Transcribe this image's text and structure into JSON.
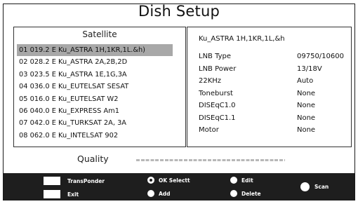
{
  "title": "Dish Setup",
  "satellite_panel": {
    "header": "Satellite",
    "items": [
      "01 019.2 E Ku_ASTRA 1H,1KR,1L.&h)",
      "02 028.2 E Ku_ASTRA 2A,2B,2D",
      "03 023.5 E Ku_ASTRA 1E,1G,3A",
      "04 036.0 E Ku_EUTELSAT SESAT",
      "05 016.0 E Ku_EUTELSAT W2",
      "06 040.0 E Ku_EXPRESS Am1",
      "07 042.0 E Ku_TURKSAT 2A, 3A",
      "08 062.0 E Ku_INTELSAT 902"
    ],
    "selected_index": 0
  },
  "info_panel": {
    "title": "Ku_ASTRA 1H,1KR,1L,&h",
    "rows": [
      {
        "label": "LNB Type",
        "value": "09750/10600"
      },
      {
        "label": "LNB Power",
        "value": "13/18V"
      },
      {
        "label": "22KHz",
        "value": "Auto"
      },
      {
        "label": "Toneburst",
        "value": "None"
      },
      {
        "label": "DISEqC1.0",
        "value": "None"
      },
      {
        "label": "DISEqC1.1",
        "value": "None"
      },
      {
        "label": "Motor",
        "value": "None"
      }
    ]
  },
  "quality": {
    "label": "Quality"
  },
  "footer": {
    "transponder": "TransPonder",
    "exit": "Exit",
    "ok_select": "OK Selectt",
    "add": "Add",
    "edit": "Edit",
    "delete": "Delete",
    "scan": "Scan"
  },
  "colors": {
    "selection": "#a8a8a8",
    "footer_bg": "#1e1e1e",
    "quality_segments": "#b8b8b8"
  }
}
